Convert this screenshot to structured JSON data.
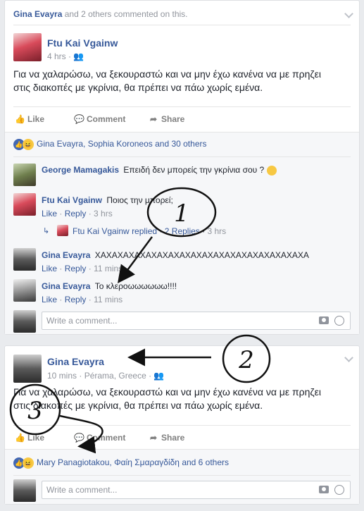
{
  "post1": {
    "header": {
      "actor": "Gina Evayra",
      "rest": "and 2 others commented on this."
    },
    "author": "Ftu Kai Vgainw",
    "time": "4 hrs",
    "text_line1": "Για να χαλαρώσω, να ξεκουραστώ και να μην έχω κανένα να με πρηζει",
    "text_line2": "στις διακοπές με γκρίνια, θα πρέπει να πάω χωρίς εμένα.",
    "actions": {
      "like": "Like",
      "comment": "Comment",
      "share": "Share"
    },
    "reactions": "Gina Evayra, Sophia Koroneos and 30 others",
    "comments": [
      {
        "author": "George Mamagakis",
        "text": "Επειδή δεν μπορείς την γκρίνια σου ?"
      },
      {
        "author": "Ftu Kai Vgainw",
        "text": "Ποιος την μπορεί;",
        "like": "Like",
        "reply": "Reply",
        "time": "3 hrs"
      },
      {
        "author": "Ftu Kai Vgainw",
        "text": "replied",
        "replies": "2 Replies",
        "time": "3 hrs"
      },
      {
        "author": "Gina Evayra",
        "text": "ΧΑΧΑΧΑΧΑΧΑΧΑΧΑΧΑΧΑΧΑΧΑΧΑΧΑΧΑΧΑΧΑΧΑΧΑΧΑ",
        "like": "Like",
        "reply": "Reply",
        "time": "11 mins"
      },
      {
        "author": "Gina Evayra",
        "text": "Το κλεροωωωωωω!!!!",
        "like": "Like",
        "reply": "Reply",
        "time": "11 mins"
      }
    ],
    "comment_placeholder": "Write a comment..."
  },
  "post2": {
    "author": "Gina Evayra",
    "time": "10 mins",
    "location": "Pérama, Greece",
    "text_line1": "Για να χαλαρώσω, να ξεκουραστώ και να μην έχω κανένα να με πρηζει",
    "text_line2": "στις διακοπές με γκρίνια, θα πρέπει να πάω χωρίς εμένα.",
    "actions": {
      "like": "Like",
      "comment": "Comment",
      "share": "Share"
    },
    "reactions": "Mary Panagiotakou, Φαίη Σμαραγδίδη and 6 others",
    "comment_placeholder": "Write a comment..."
  },
  "annotations": {
    "one": "1",
    "two": "2",
    "three": "3"
  },
  "colors": {
    "link": "#365899",
    "meta": "#90949c",
    "bg": "#e9ebee",
    "like_blue": "#4267b2"
  }
}
